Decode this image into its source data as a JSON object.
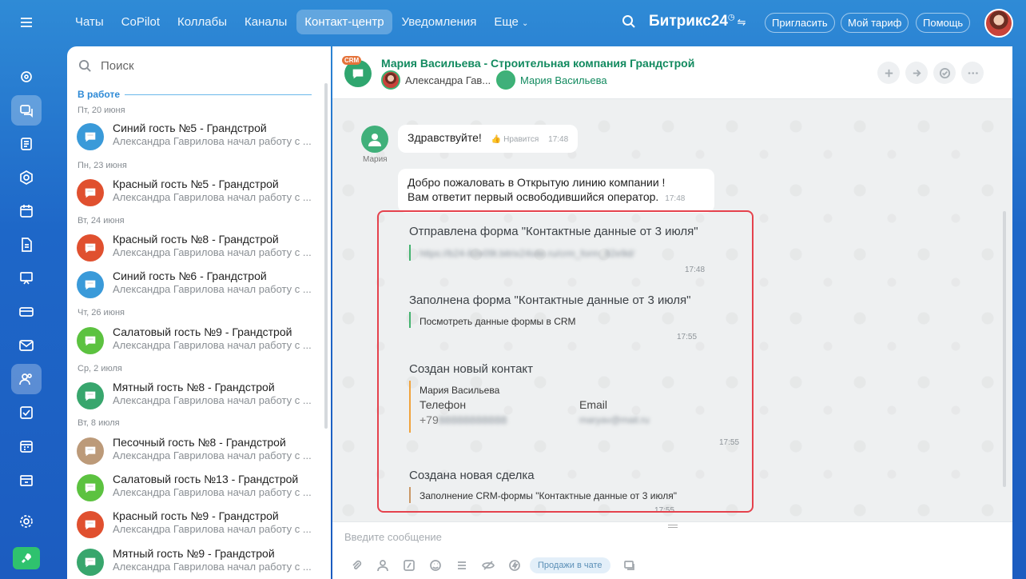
{
  "nav": {
    "items": [
      "Чаты",
      "CoPilot",
      "Коллабы",
      "Каналы",
      "Контакт-центр",
      "Уведомления",
      "Еще"
    ],
    "active_index": 4
  },
  "brand": {
    "name": "Битрикс",
    "num": "24"
  },
  "top_buttons": {
    "invite": "Пригласить",
    "tariff": "Мой тариф",
    "help": "Помощь"
  },
  "list": {
    "search_placeholder": "Поиск",
    "section": "В работе",
    "dates": [
      "Пт, 20 июня",
      "Пн, 23 июня",
      "Вт, 24 июня",
      "Чт, 26 июня",
      "Ср, 2 июля",
      "Вт, 8 июля"
    ],
    "preview": "Александра Гаврилова начал работу с ...",
    "chats": [
      {
        "name": "Синий гость №5 - Грандстрой",
        "color": "#3a9ad9"
      },
      {
        "name": "Красный гость №5 - Грандстрой",
        "color": "#e0502f"
      },
      {
        "name": "Красный гость №8 - Грандстрой",
        "color": "#e0502f"
      },
      {
        "name": "Синий гость №6 - Грандстрой",
        "color": "#3a9ad9"
      },
      {
        "name": "Салатовый гость №9 - Грандстрой",
        "color": "#5cc240"
      },
      {
        "name": "Мятный гость №8 - Грандстрой",
        "color": "#38a66d"
      },
      {
        "name": "Песочный гость №8 - Грандстрой",
        "color": "#bc9a79"
      },
      {
        "name": "Салатовый гость №13 - Грандстрой",
        "color": "#5cc240"
      },
      {
        "name": "Красный гость №9 - Грандстрой",
        "color": "#e0502f"
      },
      {
        "name": "Мятный гость №9 - Грандстрой",
        "color": "#38a66d"
      }
    ]
  },
  "chat": {
    "crm_badge": "CRM",
    "title": "Мария Васильева - Строительная компания Грандстрой",
    "user1": "Александра Гав...",
    "user2": "Мария Васильева",
    "avatar_name": "Мария",
    "msg1": {
      "text": "Здравствуйте!",
      "like": "Нравится",
      "time": "17:48"
    },
    "msg2": {
      "line1": "Добро пожаловать в Открытую линию компании !",
      "line2": "Вам ответит первый освободившийся оператор.",
      "time": "17:48"
    },
    "events": {
      "form_sent_title": "Отправлена форма \"Контактные данные от 3 июля\"",
      "form_sent_link": "https://b24-82e09t.bitrix24site.ru/crm_form_82e9d/",
      "form_sent_time": "17:48",
      "form_filled_title": "Заполнена форма \"Контактные данные от 3 июля\"",
      "form_filled_link": "Посмотреть данные формы в CRM",
      "form_filled_time": "17:55",
      "contact_title": "Создан новый контакт",
      "contact_name": "Мария Васильева",
      "phone_label": "Телефон",
      "phone_value": "+79",
      "phone_hidden": "88888888888",
      "email_label": "Email",
      "email_value": "maryav@mail.ru",
      "contact_time": "17:55",
      "deal_title": "Создана новая сделка",
      "deal_text": "Заполнение CRM-формы \"Контактные данные от 3 июля\"",
      "deal_time": "17:55"
    },
    "input_placeholder": "Введите сообщение",
    "sales_button": "Продажи в чате"
  }
}
